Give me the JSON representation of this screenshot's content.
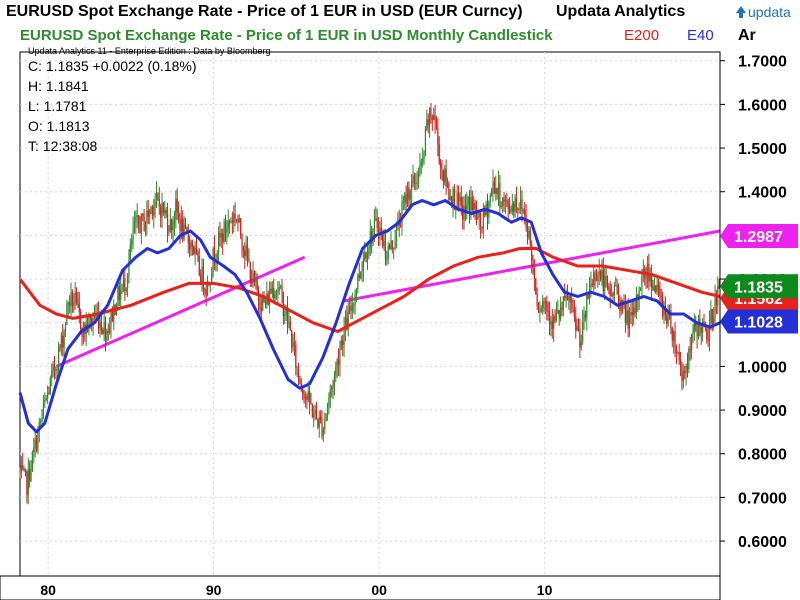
{
  "window": {
    "title": "EURUSD Spot Exchange Rate - Price of 1 EUR in USD (EUR Curncy)",
    "brand": "Updata Analytics",
    "logo_text": "updata"
  },
  "chart_header": {
    "title": "EURUSD Spot Exchange Rate - Price of 1 EUR in USD Monthly Candlestick",
    "e200_label": "E200",
    "e40_label": "E40",
    "axis_corner": "Ar",
    "credit": "Updata Analytics 11 - Enterprise Edition : Data by Bloomberg"
  },
  "readout": {
    "close": "C: 1.1835  +0.0022 (0.18%)",
    "high": "H: 1.1841",
    "low": "L: 1.1781",
    "open": "O: 1.1813",
    "time": "T: 12:38:08"
  },
  "colors": {
    "up": "#2e8b2e",
    "down": "#cc2222",
    "e200": "#e8211a",
    "e40": "#2330d6",
    "trend": "#ee22ee",
    "tag_trend": "#ee22ee",
    "tag_last": "#0c8a1c",
    "tag_e200": "#e8211a",
    "tag_e40": "#2330d6"
  },
  "chart_data": {
    "type": "candlestick",
    "title": "EURUSD Spot Exchange Rate - Price of 1 EUR in USD Monthly Candlestick",
    "ylim": [
      0.52,
      1.72
    ],
    "xlim": [
      1978.3,
      2020.6
    ],
    "y_ticks": [
      "0.6000",
      "0.7000",
      "0.8000",
      "0.9000",
      "1.0000",
      "1.1000",
      "1.2000",
      "1.3000",
      "1.4000",
      "1.5000",
      "1.6000",
      "1.7000"
    ],
    "y_tick_values": [
      0.6,
      0.7,
      0.8,
      0.9,
      1.0,
      1.1,
      1.2,
      1.3,
      1.4,
      1.5,
      1.6,
      1.7
    ],
    "x_ticks": [
      {
        "label": "80",
        "year": 1980
      },
      {
        "label": "90",
        "year": 1990
      },
      {
        "label": "00",
        "year": 2000
      },
      {
        "label": "10",
        "year": 2010
      }
    ],
    "grid": true,
    "price_anchors": [
      [
        1978.3,
        0.76
      ],
      [
        1978.8,
        0.73
      ],
      [
        1979.2,
        0.8
      ],
      [
        1979.8,
        0.9
      ],
      [
        1980.5,
        1.0
      ],
      [
        1981.0,
        1.07
      ],
      [
        1981.3,
        1.15
      ],
      [
        1981.7,
        1.15
      ],
      [
        1982.2,
        1.08
      ],
      [
        1982.6,
        1.1
      ],
      [
        1983.0,
        1.12
      ],
      [
        1983.6,
        1.08
      ],
      [
        1984.3,
        1.16
      ],
      [
        1984.8,
        1.2
      ],
      [
        1985.3,
        1.32
      ],
      [
        1985.9,
        1.33
      ],
      [
        1986.5,
        1.38
      ],
      [
        1987.0,
        1.36
      ],
      [
        1987.5,
        1.32
      ],
      [
        1987.8,
        1.36
      ],
      [
        1988.3,
        1.3
      ],
      [
        1988.8,
        1.28
      ],
      [
        1989.2,
        1.22
      ],
      [
        1989.7,
        1.18
      ],
      [
        1990.1,
        1.26
      ],
      [
        1990.6,
        1.3
      ],
      [
        1991.0,
        1.33
      ],
      [
        1991.4,
        1.35
      ],
      [
        1991.9,
        1.28
      ],
      [
        1992.4,
        1.2
      ],
      [
        1992.8,
        1.16
      ],
      [
        1993.2,
        1.14
      ],
      [
        1993.6,
        1.18
      ],
      [
        1994.0,
        1.18
      ],
      [
        1994.6,
        1.1
      ],
      [
        1995.2,
        0.98
      ],
      [
        1995.8,
        0.92
      ],
      [
        1996.3,
        0.88
      ],
      [
        1996.7,
        0.86
      ],
      [
        1997.0,
        0.92
      ],
      [
        1997.4,
        0.98
      ],
      [
        1997.8,
        1.06
      ],
      [
        1998.3,
        1.12
      ],
      [
        1998.8,
        1.2
      ],
      [
        1999.2,
        1.26
      ],
      [
        1999.6,
        1.3
      ],
      [
        2000.0,
        1.33
      ],
      [
        2000.5,
        1.26
      ],
      [
        2000.9,
        1.28
      ],
      [
        2001.3,
        1.33
      ],
      [
        2001.8,
        1.4
      ],
      [
        2002.2,
        1.42
      ],
      [
        2002.7,
        1.46
      ],
      [
        2003.0,
        1.56
      ],
      [
        2003.4,
        1.58
      ],
      [
        2003.8,
        1.46
      ],
      [
        2004.3,
        1.4
      ],
      [
        2004.7,
        1.38
      ],
      [
        2005.2,
        1.35
      ],
      [
        2005.6,
        1.38
      ],
      [
        2006.2,
        1.32
      ],
      [
        2006.6,
        1.36
      ],
      [
        2007.0,
        1.42
      ],
      [
        2007.5,
        1.38
      ],
      [
        2007.9,
        1.36
      ],
      [
        2008.3,
        1.38
      ],
      [
        2008.8,
        1.36
      ],
      [
        2009.1,
        1.31
      ],
      [
        2009.4,
        1.22
      ],
      [
        2009.7,
        1.14
      ],
      [
        2010.1,
        1.15
      ],
      [
        2010.6,
        1.1
      ],
      [
        2011.0,
        1.12
      ],
      [
        2011.5,
        1.16
      ],
      [
        2011.9,
        1.1
      ],
      [
        2012.3,
        1.06
      ],
      [
        2012.8,
        1.18
      ],
      [
        2013.2,
        1.22
      ],
      [
        2013.6,
        1.2
      ],
      [
        2014.0,
        1.16
      ],
      [
        2014.4,
        1.18
      ],
      [
        2014.9,
        1.12
      ],
      [
        2015.4,
        1.1
      ],
      [
        2015.9,
        1.2
      ],
      [
        2016.3,
        1.22
      ],
      [
        2016.8,
        1.18
      ],
      [
        2017.2,
        1.14
      ],
      [
        2017.7,
        1.1
      ],
      [
        2018.0,
        1.05
      ],
      [
        2018.4,
        0.98
      ],
      [
        2018.8,
        1.02
      ],
      [
        2019.1,
        1.08
      ],
      [
        2019.5,
        1.1
      ],
      [
        2019.9,
        1.06
      ],
      [
        2020.2,
        1.12
      ],
      [
        2020.6,
        1.18
      ]
    ],
    "series": [
      {
        "name": "E200",
        "points": [
          [
            1978.3,
            1.2
          ],
          [
            1979.5,
            1.14
          ],
          [
            1980.5,
            1.12
          ],
          [
            1981.5,
            1.11
          ],
          [
            1983.0,
            1.12
          ],
          [
            1985.0,
            1.14
          ],
          [
            1987.0,
            1.17
          ],
          [
            1988.5,
            1.19
          ],
          [
            1990.0,
            1.19
          ],
          [
            1991.5,
            1.18
          ],
          [
            1993.0,
            1.16
          ],
          [
            1994.5,
            1.13
          ],
          [
            1996.0,
            1.1
          ],
          [
            1997.5,
            1.08
          ],
          [
            1998.5,
            1.1
          ],
          [
            2000.0,
            1.13
          ],
          [
            2001.5,
            1.16
          ],
          [
            2003.0,
            1.2
          ],
          [
            2004.5,
            1.23
          ],
          [
            2006.0,
            1.25
          ],
          [
            2007.5,
            1.26
          ],
          [
            2008.5,
            1.27
          ],
          [
            2009.5,
            1.27
          ],
          [
            2010.5,
            1.25
          ],
          [
            2012.0,
            1.23
          ],
          [
            2013.5,
            1.23
          ],
          [
            2015.0,
            1.22
          ],
          [
            2016.5,
            1.21
          ],
          [
            2018.0,
            1.19
          ],
          [
            2019.5,
            1.17
          ],
          [
            2020.6,
            1.16
          ]
        ]
      },
      {
        "name": "E40",
        "points": [
          [
            1978.3,
            0.94
          ],
          [
            1978.8,
            0.87
          ],
          [
            1979.3,
            0.85
          ],
          [
            1979.8,
            0.87
          ],
          [
            1980.5,
            0.96
          ],
          [
            1981.2,
            1.04
          ],
          [
            1982.0,
            1.08
          ],
          [
            1982.8,
            1.1
          ],
          [
            1983.6,
            1.14
          ],
          [
            1984.5,
            1.22
          ],
          [
            1985.3,
            1.25
          ],
          [
            1986.0,
            1.27
          ],
          [
            1986.6,
            1.26
          ],
          [
            1987.3,
            1.27
          ],
          [
            1988.0,
            1.3
          ],
          [
            1988.6,
            1.31
          ],
          [
            1989.2,
            1.29
          ],
          [
            1989.8,
            1.25
          ],
          [
            1990.6,
            1.23
          ],
          [
            1991.3,
            1.21
          ],
          [
            1992.0,
            1.17
          ],
          [
            1992.8,
            1.11
          ],
          [
            1993.6,
            1.04
          ],
          [
            1994.5,
            0.97
          ],
          [
            1995.2,
            0.95
          ],
          [
            1995.8,
            0.96
          ],
          [
            1996.6,
            1.02
          ],
          [
            1997.4,
            1.1
          ],
          [
            1998.2,
            1.19
          ],
          [
            1999.0,
            1.27
          ],
          [
            1999.8,
            1.3
          ],
          [
            2000.5,
            1.31
          ],
          [
            2001.2,
            1.33
          ],
          [
            2002.0,
            1.37
          ],
          [
            2002.6,
            1.38
          ],
          [
            2003.3,
            1.37
          ],
          [
            2004.0,
            1.38
          ],
          [
            2004.8,
            1.36
          ],
          [
            2005.6,
            1.35
          ],
          [
            2006.4,
            1.36
          ],
          [
            2007.2,
            1.35
          ],
          [
            2008.0,
            1.33
          ],
          [
            2008.6,
            1.34
          ],
          [
            2009.2,
            1.33
          ],
          [
            2009.8,
            1.26
          ],
          [
            2010.5,
            1.21
          ],
          [
            2011.2,
            1.17
          ],
          [
            2012.0,
            1.16
          ],
          [
            2012.8,
            1.17
          ],
          [
            2013.6,
            1.16
          ],
          [
            2014.4,
            1.14
          ],
          [
            2015.2,
            1.15
          ],
          [
            2016.0,
            1.16
          ],
          [
            2016.8,
            1.15
          ],
          [
            2017.6,
            1.12
          ],
          [
            2018.4,
            1.12
          ],
          [
            2019.2,
            1.1
          ],
          [
            2020.0,
            1.09
          ],
          [
            2020.6,
            1.1
          ]
        ]
      }
    ],
    "trendlines": [
      {
        "from": [
          1980.5,
          1.0
        ],
        "to": [
          1995.5,
          1.25
        ]
      },
      {
        "from": [
          1997.9,
          1.15
        ],
        "to": [
          2021.0,
          1.31
        ]
      }
    ],
    "right_tags": [
      {
        "label": "1.2987",
        "value": 1.2987,
        "color_key": "tag_trend"
      },
      {
        "label": "1.1562",
        "value": 1.1562,
        "color_key": "tag_e200"
      },
      {
        "label": "1.1835",
        "value": 1.1835,
        "color_key": "tag_last"
      },
      {
        "label": "1.1028",
        "value": 1.1028,
        "color_key": "tag_e40"
      }
    ]
  }
}
